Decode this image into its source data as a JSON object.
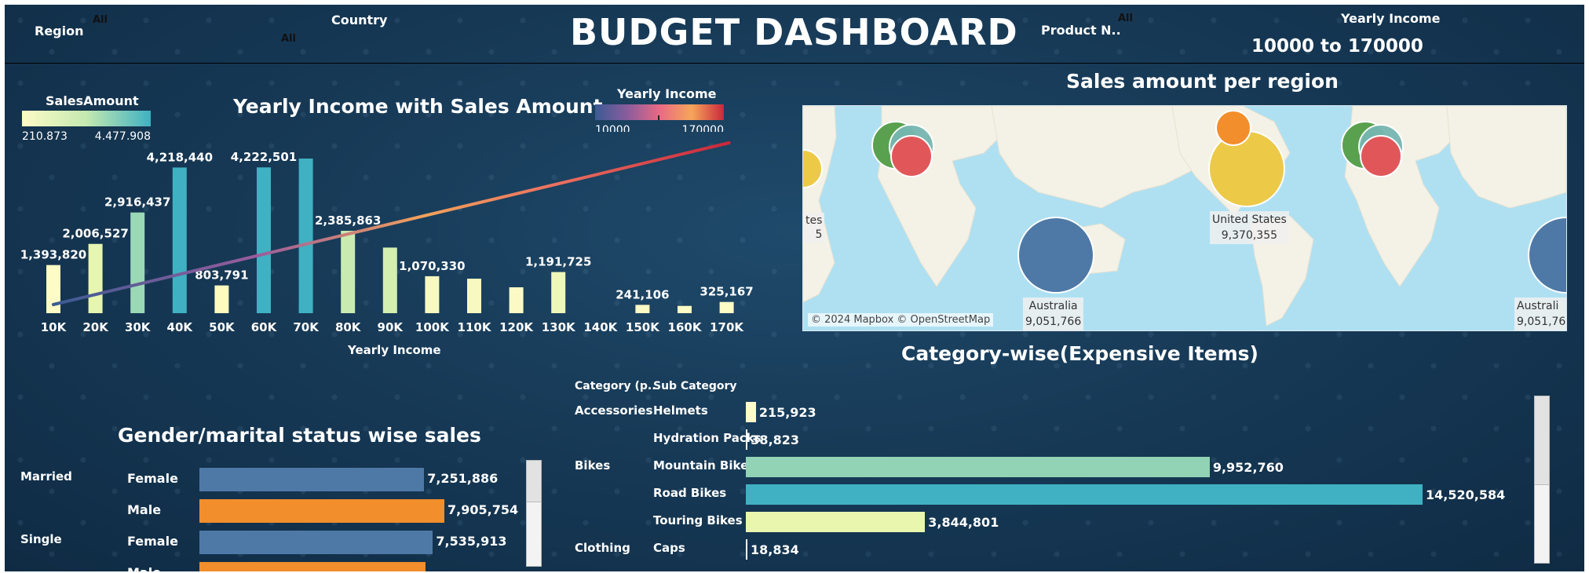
{
  "filters": {
    "region": {
      "label": "Region",
      "value": "All"
    },
    "country": {
      "label": "Country",
      "value": "All"
    },
    "product": {
      "label": "Product N..",
      "value": "All"
    },
    "yearly_income": {
      "label": "Yearly Income",
      "value": "10000 to 170000"
    }
  },
  "dashboard_title": "BUDGET DASHBOARD",
  "income_chart": {
    "title": "Yearly Income with Sales Amount",
    "xlabel": "Yearly Income",
    "sales_legend": {
      "title": "SalesAmount",
      "min": "210,873",
      "max": "4,477,908"
    },
    "income_legend": {
      "title": "Yearly Income",
      "min": "10000",
      "max": "170000"
    }
  },
  "map": {
    "title": "Sales amount per region",
    "attribution": "© 2024 Mapbox © OpenStreetMap",
    "labels": [
      {
        "name": "United States",
        "value": "9,370,355"
      },
      {
        "name": "Australia",
        "value": "9,051,766"
      },
      {
        "name": "Australi",
        "value": "9,051,766"
      },
      {
        "name": "tes",
        "value": "5"
      }
    ]
  },
  "gender": {
    "title": "Gender/marital status wise sales",
    "groups": [
      "Married",
      "Single"
    ],
    "rows": [
      {
        "group": "Married",
        "gender": "Female",
        "value": 7251886,
        "label": "7,251,886",
        "color": "#4e79a7"
      },
      {
        "group": "",
        "gender": "Male",
        "value": 7905754,
        "label": "7,905,754",
        "color": "#f28e2b"
      },
      {
        "group": "Single",
        "gender": "Female",
        "value": 7535913,
        "label": "7,535,913",
        "color": "#4e79a7"
      },
      {
        "group": "",
        "gender": "Male",
        "value": 7300000,
        "label": "",
        "color": "#f28e2b"
      }
    ]
  },
  "category": {
    "title": "Category-wise(Expensive Items)",
    "header_category": "Category (p..",
    "header_sub": "Sub Category",
    "rows": [
      {
        "category": "Accessories",
        "sub": "Helmets",
        "value": 215923,
        "label": "215,923",
        "color": "#fdfbc6"
      },
      {
        "category": "",
        "sub": "Hydration Packs",
        "value": 38823,
        "label": "38,823",
        "color": "#ffffff"
      },
      {
        "category": "Bikes",
        "sub": "Mountain Bikes",
        "value": 9952760,
        "label": "9,952,760",
        "color": "#91d3b4"
      },
      {
        "category": "",
        "sub": "Road Bikes",
        "value": 14520584,
        "label": "14,520,584",
        "color": "#3fb1c2"
      },
      {
        "category": "",
        "sub": "Touring Bikes",
        "value": 3844801,
        "label": "3,844,801",
        "color": "#e9f6ad"
      },
      {
        "category": "Clothing",
        "sub": "Caps",
        "value": 18834,
        "label": "18,834",
        "color": "#ffffff"
      }
    ]
  },
  "chart_data": {
    "type": "bar",
    "title": "Yearly Income with Sales Amount",
    "xlabel": "Yearly Income",
    "categories": [
      "10K",
      "20K",
      "30K",
      "40K",
      "50K",
      "60K",
      "70K",
      "80K",
      "90K",
      "100K",
      "110K",
      "120K",
      "130K",
      "140K",
      "150K",
      "160K",
      "170K"
    ],
    "values": [
      1393820,
      2006527,
      2916437,
      4218440,
      803791,
      4222501,
      4477908,
      2385863,
      1900000,
      1070330,
      1000000,
      750000,
      1191725,
      0,
      241106,
      210873,
      325167
    ],
    "labels": [
      "1,393,820",
      "2,006,527",
      "2,916,437",
      "4,218,440",
      "803,791",
      "4,222,501",
      "",
      "2,385,863",
      "",
      "1,070,330",
      "",
      "",
      "1,191,725",
      "",
      "241,106",
      "",
      "325,167"
    ],
    "colors": [
      "#fdfbc6",
      "#e6f5b0",
      "#9bd8b5",
      "#3fb1c2",
      "#fffbbf",
      "#3fb1c2",
      "#3fb1c2",
      "#c9ebb1",
      "#d4efaf",
      "#f8f9c0",
      "#f8f9c0",
      "#fbfac4",
      "#eef8b8",
      "#fdfbc6",
      "#fdfbc6",
      "#fdfbc6",
      "#fdfbc6"
    ],
    "ylim": [
      0,
      4477908
    ],
    "trend_line": {
      "from": 10000,
      "to": 170000
    }
  }
}
